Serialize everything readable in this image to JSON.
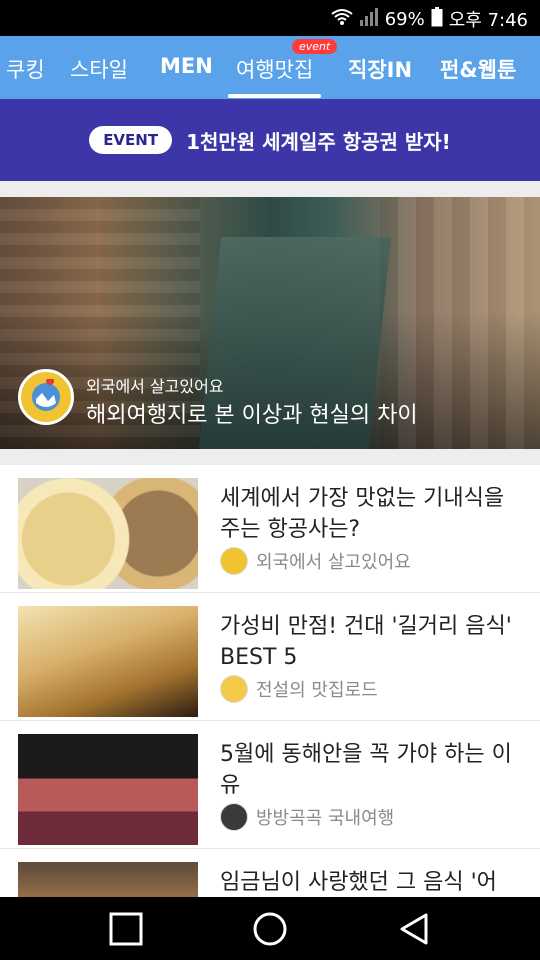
{
  "status": {
    "battery": "69%",
    "time": "오후 7:46",
    "icons": [
      "wifi-icon",
      "signal-icon",
      "battery-icon"
    ]
  },
  "tabs": [
    {
      "label": "쿠킹"
    },
    {
      "label": "스타일"
    },
    {
      "label": "MEN"
    },
    {
      "label": "여행맛집",
      "active": true,
      "badge": "event"
    },
    {
      "label": "직장IN"
    },
    {
      "label": "펀&웹툰"
    }
  ],
  "event_banner": {
    "pill": "EVENT",
    "text": "1천만원 세계일주 항공권 받자!"
  },
  "hero": {
    "channel": "외국에서 살고있어요",
    "title": "해외여행지로 본 이상과 현실의 차이"
  },
  "articles": [
    {
      "title": "세계에서 가장 맛없는 기내식을 주는 항공사는?",
      "channel": "외국에서 살고있어요",
      "avatar_color": "#f1c232"
    },
    {
      "title": "가성비 만점! 건대 '길거리 음식' BEST 5",
      "channel": "전설의 맛집로드",
      "avatar_color": "#f3c94a"
    },
    {
      "title": "5월에 동해안을 꼭 가야 하는 이유",
      "channel": "방방곡곡 국내여행",
      "avatar_color": "#3a3a3a"
    },
    {
      "title": "임금님이 사랑했던 그 음식 '어",
      "channel": "",
      "avatar_color": "#cccccc"
    }
  ],
  "colors": {
    "tabbar": "#5aa3ea",
    "event_banner": "#3d36a8",
    "badge": "#ff3b3b"
  }
}
